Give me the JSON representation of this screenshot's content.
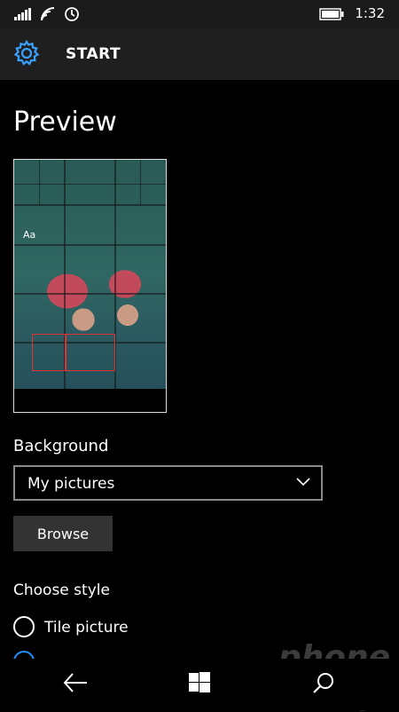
{
  "status": {
    "time": "1:32"
  },
  "header": {
    "title": "START"
  },
  "page": {
    "title": "Preview"
  },
  "preview": {
    "tile_text": "Aa"
  },
  "background": {
    "label": "Background",
    "selected": "My pictures",
    "browse_label": "Browse"
  },
  "style": {
    "label": "Choose style",
    "option1": "Tile picture"
  },
  "watermark": {
    "text": "phone scoop"
  },
  "colors": {
    "accent": "#1e90ff",
    "header_bg": "#1f1f1f"
  },
  "icons": [
    "signal-icon",
    "wifi-icon",
    "do-not-disturb-icon",
    "battery-icon",
    "gear-icon",
    "chevron-down-icon",
    "back-icon",
    "windows-icon",
    "search-icon"
  ]
}
